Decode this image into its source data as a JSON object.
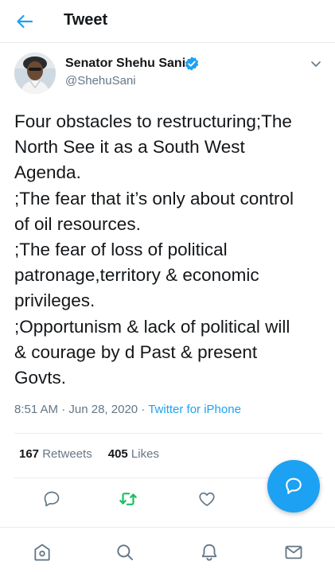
{
  "header": {
    "title": "Tweet",
    "back_icon": "arrow-left-icon"
  },
  "author": {
    "display_name": "Senator Shehu Sani",
    "handle": "@ShehuSani",
    "verified": true,
    "avatar_icon": "avatar-photo",
    "menu_icon": "chevron-down-icon"
  },
  "tweet": {
    "lines": [
      "Four obstacles to restructuring;The",
      "North See it as a South West",
      "Agenda.",
      ";The fear that it’s only about control",
      "of oil resources.",
      ";The fear of loss of political",
      "patronage,territory & economic",
      "privileges.",
      ";Opportunism & lack of political will",
      "& courage by d Past & present",
      "Govts."
    ]
  },
  "meta": {
    "time": "8:51 AM",
    "separator": " · ",
    "date": "Jun 28, 2020",
    "source": "Twitter for iPhone"
  },
  "stats": {
    "retweets_count": "167",
    "retweets_label": " Retweets",
    "likes_count": "405",
    "likes_label": " Likes"
  },
  "actions": {
    "reply_icon": "reply-icon",
    "retweet_icon": "retweet-icon",
    "like_icon": "heart-icon",
    "compose_icon": "compose-reply-icon"
  },
  "nav": {
    "items": [
      "home-icon",
      "search-icon",
      "notifications-icon",
      "messages-icon"
    ]
  },
  "colors": {
    "accent": "#1da1f2",
    "retweet": "#17bf63",
    "text": "#14171a",
    "muted": "#657786",
    "border": "#e6ecf0"
  }
}
